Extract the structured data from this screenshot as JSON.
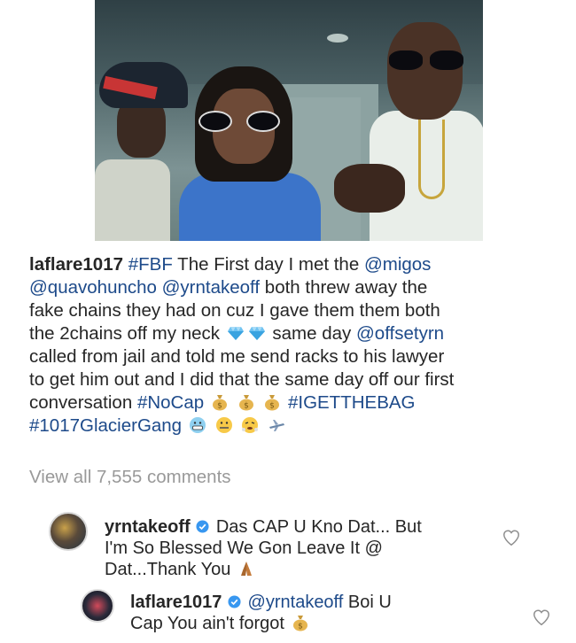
{
  "post": {
    "username": "laflare1017",
    "caption_parts": {
      "p1": "#FBF",
      "p2": " The First day I met the ",
      "p3": "@migos",
      "p4": "@quavohuncho",
      "p5": " ",
      "p6": "@yrntakeoff",
      "p7": " both threw away the",
      "p8": "fake chains they had on cuz I gave them them both",
      "p9": "the 2chains off my neck",
      "p10": " same day ",
      "p11": "@offsetyrn",
      "p12": "called from jail and told me send racks to his lawyer",
      "p13": "to get him out and I did that the same day off our first",
      "p14": "conversation ",
      "p15": "#NoCap",
      "p16": "#IGETTHEBAG",
      "p17": "#1017GlacierGang"
    },
    "icons": {
      "gem": "gem-icon",
      "money_bag": "money-bag-icon",
      "grimace": "grimacing-face-icon",
      "zipper": "zipper-mouth-face-icon",
      "steam": "face-with-steam-icon",
      "plane": "airplane-icon"
    }
  },
  "view_all_comments": "View all 7,555 comments",
  "comments": [
    {
      "username": "yrntakeoff",
      "line1": "Das CAP U Kno Dat... But",
      "line2": "I'm So Blessed We Gon Leave It @",
      "line3": "Dat...Thank You",
      "icon": "folded-hands-icon"
    },
    {
      "username": "laflare1017",
      "mention": "@yrntakeoff",
      "line1_rest": " Boi U",
      "line2": "Cap You ain't forgot",
      "icon": "money-bag-icon"
    }
  ],
  "colors": {
    "text": "#262626",
    "hashtag": "#1d4a8a",
    "muted": "#999999",
    "verified": "#3897f0"
  }
}
